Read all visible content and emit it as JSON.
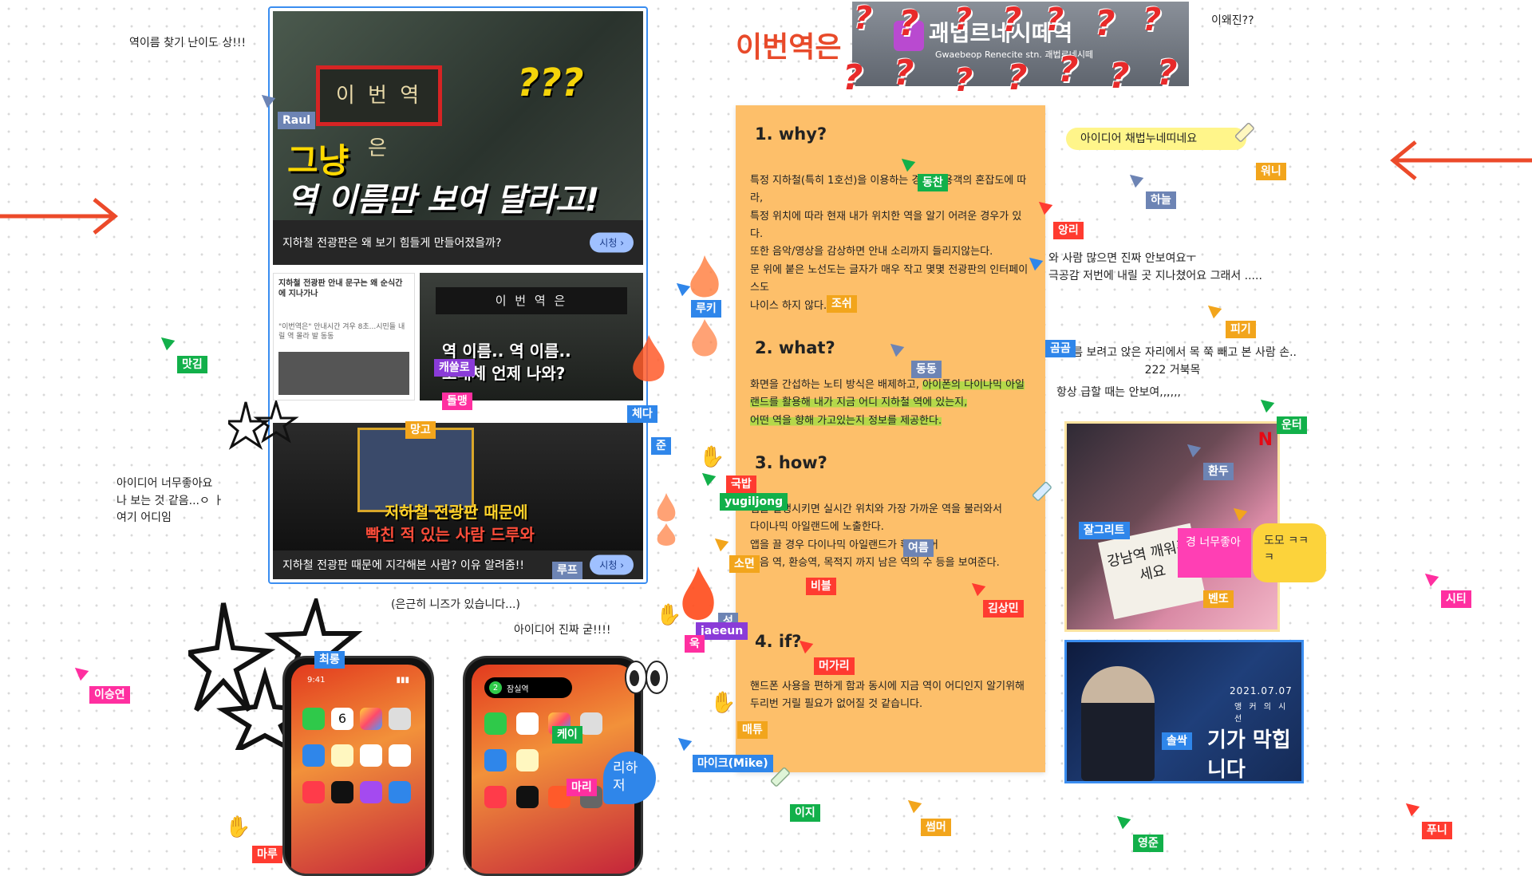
{
  "board": {
    "notes": {
      "difficulty": "역이름 찾기 난이도 상!!!",
      "why_changed": "이왜진??",
      "idea_good": "아이디어 너무좋아요\n나 보는 것 같음...ㅇ ㅏ\n여기 어디임",
      "needs": "(은근히 니즈가 있습니다...)",
      "idea_awesome": "아이디어 진짜 굳!!!!",
      "idea_adopt": "아이디어 채법누네띠네요",
      "crowd": "와 사람 많으면 진짜 안보여요ㅜ\n극공감 저번에 내릴 곳 지나쳤어요 그래서 .....",
      "neck": "역 이름 보려고 앉은 자리에서 목 쭉 빼고 본 사람 손..\n222 거북목",
      "hurry": "항상 급할 때는 안보여,,,,,,"
    },
    "station_title": "이번역은",
    "station_sign": {
      "name": "괘법르네시떼역",
      "en": "Gwaebeop Renecite stn. 괘법르네시떼"
    },
    "collage": {
      "top": {
        "sign": "이 번 역 은",
        "qmarks": "???",
        "headline1": "그냥",
        "headline2": "역 이름만 보여 달라고!",
        "caption": "지하철 전광판은 왜 보기 힘들게 만들어졌을까?",
        "button": "시청 ›"
      },
      "article": {
        "title": "지하철 전광판 안내 문구는 왜 순식간에 지나가나",
        "lead": "\"이번역은\" 안내시간 겨우 8초...시민들 내릴 역 몰라 발 동동"
      },
      "mid": {
        "sign": "이 번 역 은",
        "line1": "역 이름.. 역 이름..",
        "line2": "도대체 언제 나와?"
      },
      "bottom": {
        "line1": "지하철 전광판 때문에",
        "line2": "빡친 적 있는 사람 드루와",
        "caption": "지하철 전광판 때문에 지각해본 사람? 이유 알려줌!!",
        "button": "시청 ›"
      }
    },
    "orange_note": {
      "why_heading": "1. why?",
      "why_body1": "특정 지하철(특히 1호선)을 이용하는 경우 이용객의 혼잡도에 따라,",
      "why_body2": "특정 위치에 따라 현재 내가 위치한 역을 알기 어려운 경우가 있다.",
      "why_body3": "또한 음악/영상을 감상하면 안내 소리까지 들리지않는다.",
      "why_body4": "문 위에 붙은 노선도는 글자가 매우 작고 몇몇 전광판의 인터페이스도",
      "why_body5": "나이스 하지 않다.",
      "what_heading": "2. what?",
      "what_body_plain": "화면을 간섭하는 노티 방식은 배제하고, ",
      "what_body_hl1": "아이폰의 다이나믹 아일랜드를 활용해 내가 지금 어디 지하철 역에 있는지,",
      "what_body_hl2": "어떤 역을 향해 가고있는지 정보를 제공한다.",
      "how_heading": "3. how?",
      "how_body1": "앱을 실행시키면 실시간 위치와 가장 가까운 역을 불러와서",
      "how_body2": "다이나믹 아일랜드에 노출한다.",
      "how_body3": "앱을 끌 경우 다이나믹 아일랜드가 확장되어",
      "how_body4": "다음 역, 환승역, 목적지 까지 남은 역의 수 등을 보여준다.",
      "if_heading": "4. if?",
      "if_body1": "핸드폰 사용을 편하게 함과 동시에 지금 역이 어디인지 알기위해",
      "if_body2": "두리번 거릴 필요가 없어질 것 같습니다."
    },
    "drama": {
      "sign": "강남역\n깨워주세요",
      "pink": "경\n너무좋아",
      "yellow": "도모\nㅋㅋㅋ"
    },
    "anchor": {
      "date": "2021.07.07",
      "sub": "앵 커 의  시 선",
      "caption": "기가 막힙니다"
    },
    "bubble": "리하\n저",
    "phone_left": {
      "time": "9:41",
      "date_num": "6"
    },
    "phone_right": {
      "badge": "2",
      "station": "잠실역"
    },
    "cursors": [
      {
        "name": "Raul",
        "color": "#6d84b4"
      },
      {
        "name": "맛김",
        "color": "#12b04a"
      },
      {
        "name": "캐쓸로",
        "color": "#8a3bd8"
      },
      {
        "name": "돌맹",
        "color": "#ff2fa0"
      },
      {
        "name": "망고",
        "color": "#f2a51c"
      },
      {
        "name": "준",
        "color": "#2f86ea"
      },
      {
        "name": "체다",
        "color": "#2f86ea"
      },
      {
        "name": "루프",
        "color": "#6d84b4"
      },
      {
        "name": "루키",
        "color": "#2f86ea"
      },
      {
        "name": "동찬",
        "color": "#12b04a"
      },
      {
        "name": "조쉬",
        "color": "#f2a51c"
      },
      {
        "name": "동동",
        "color": "#6d84b4"
      },
      {
        "name": "국밥",
        "color": "#ff3b30"
      },
      {
        "name": "yugiljong",
        "color": "#12b04a"
      },
      {
        "name": "소면",
        "color": "#f2a51c"
      },
      {
        "name": "여름",
        "color": "#6d84b4"
      },
      {
        "name": "비블",
        "color": "#ff3b30"
      },
      {
        "name": "김상민",
        "color": "#ff3b30"
      },
      {
        "name": "성",
        "color": "#6d84b4"
      },
      {
        "name": "jaeeun",
        "color": "#8a3bd8"
      },
      {
        "name": "욱",
        "color": "#ff2fa0"
      },
      {
        "name": "머가리",
        "color": "#ff3b30"
      },
      {
        "name": "매튜",
        "color": "#f2a51c"
      },
      {
        "name": "케이",
        "color": "#12b04a"
      },
      {
        "name": "마리",
        "color": "#ff2fa0"
      },
      {
        "name": "마이크(Mike)",
        "color": "#2f86ea"
      },
      {
        "name": "이지",
        "color": "#12b04a"
      },
      {
        "name": "썸머",
        "color": "#f2a51c"
      },
      {
        "name": "최롱",
        "color": "#2f86ea"
      },
      {
        "name": "이승연",
        "color": "#ff2fa0"
      },
      {
        "name": "마루",
        "color": "#ff3b30"
      },
      {
        "name": "앙리",
        "color": "#ff3b30"
      },
      {
        "name": "하늘",
        "color": "#6d84b4"
      },
      {
        "name": "워니",
        "color": "#f2a51c"
      },
      {
        "name": "피기",
        "color": "#f2a51c"
      },
      {
        "name": "곰곰",
        "color": "#2f86ea"
      },
      {
        "name": "운터",
        "color": "#12b04a"
      },
      {
        "name": "환두",
        "color": "#6d84b4"
      },
      {
        "name": "잘그리트",
        "color": "#2f86ea"
      },
      {
        "name": "벤또",
        "color": "#f2a51c"
      },
      {
        "name": "솔싹",
        "color": "#2f86ea"
      },
      {
        "name": "시티",
        "color": "#ff2fa0"
      },
      {
        "name": "푸니",
        "color": "#ff3b30"
      },
      {
        "name": "영준",
        "color": "#12b04a"
      }
    ]
  }
}
